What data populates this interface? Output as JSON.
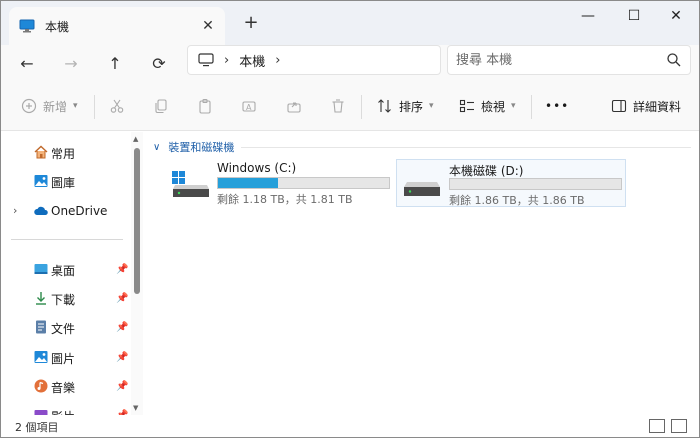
{
  "window": {
    "tab_title": "本機",
    "new_tab": "+",
    "min": "—",
    "max": "☐",
    "close": "✕",
    "tab_close": "✕"
  },
  "nav": {
    "back": "←",
    "forward": "→",
    "up": "↑",
    "refresh": "⟳",
    "breadcrumb": "本機",
    "breadcrumb_sep": "›",
    "search_placeholder": "搜尋 本機"
  },
  "commands": {
    "new_label": "新增",
    "sort_label": "排序",
    "view_label": "檢視",
    "more": "•••",
    "details_label": "詳細資料"
  },
  "sidebar": {
    "items": [
      {
        "label": "常用",
        "icon": "home-icon"
      },
      {
        "label": "圖庫",
        "icon": "gallery-icon"
      },
      {
        "label": "OneDrive",
        "icon": "cloud-icon"
      },
      {
        "label": "桌面",
        "icon": "desktop-icon"
      },
      {
        "label": "下載",
        "icon": "download-icon"
      },
      {
        "label": "文件",
        "icon": "document-icon"
      },
      {
        "label": "圖片",
        "icon": "pictures-icon"
      },
      {
        "label": "音樂",
        "icon": "music-icon"
      },
      {
        "label": "影片",
        "icon": "video-icon"
      }
    ],
    "expand": "›",
    "pin": "📌"
  },
  "main": {
    "group_title": "裝置和磁碟機",
    "drives": [
      {
        "name": "Windows (C:)",
        "usage": 0.35,
        "space_text": "剩餘 1.18 TB，共 1.81 TB"
      },
      {
        "name": "本機磁碟 (D:)",
        "usage": 0.0,
        "space_text": "剩餘 1.86 TB，共 1.86 TB"
      }
    ]
  },
  "status": {
    "count": "2 個項目"
  },
  "colors": {
    "accent": "#26a0da",
    "group_header": "#1f5fa8"
  }
}
